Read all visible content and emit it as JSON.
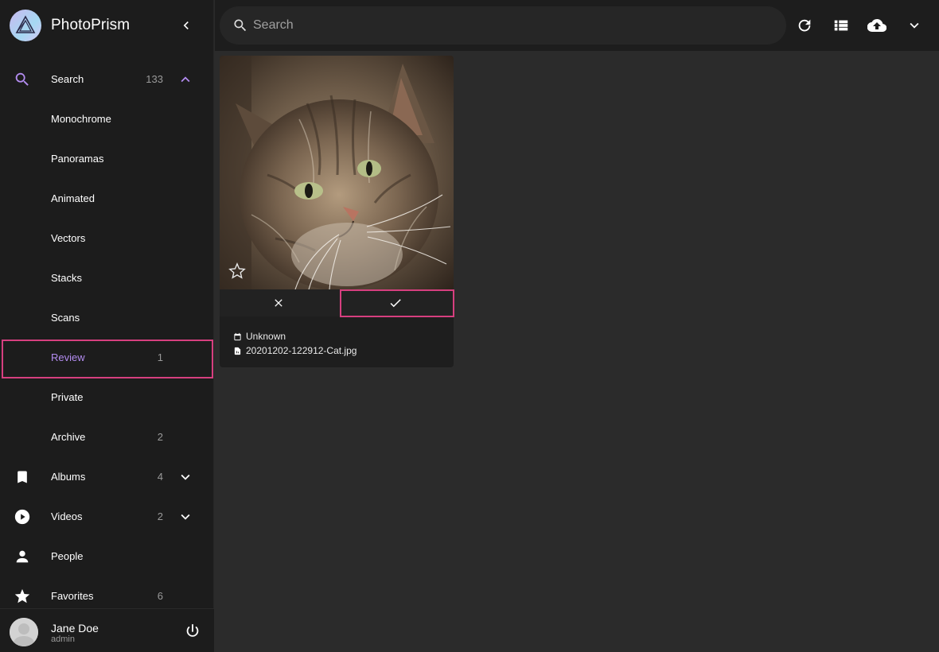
{
  "app": {
    "title": "PhotoPrism"
  },
  "sidebar": {
    "search": {
      "label": "Search",
      "count": "133"
    },
    "sub_items": [
      {
        "label": "Monochrome"
      },
      {
        "label": "Panoramas"
      },
      {
        "label": "Animated"
      },
      {
        "label": "Vectors"
      },
      {
        "label": "Stacks"
      },
      {
        "label": "Scans"
      },
      {
        "label": "Review",
        "count": "1"
      },
      {
        "label": "Private"
      },
      {
        "label": "Archive",
        "count": "2"
      }
    ],
    "albums": {
      "label": "Albums",
      "count": "4"
    },
    "videos": {
      "label": "Videos",
      "count": "2"
    },
    "people": {
      "label": "People"
    },
    "favorites": {
      "label": "Favorites",
      "count": "6"
    }
  },
  "user": {
    "name": "Jane Doe",
    "role": "admin"
  },
  "search": {
    "placeholder": "Search"
  },
  "card": {
    "date": "Unknown",
    "filename": "20201202-122912-Cat.jpg"
  },
  "colors": {
    "accent": "#b38cf0",
    "highlight": "#d63f7f",
    "sidebar_bg": "#1c1c1c",
    "content_bg": "#2b2b2b"
  }
}
